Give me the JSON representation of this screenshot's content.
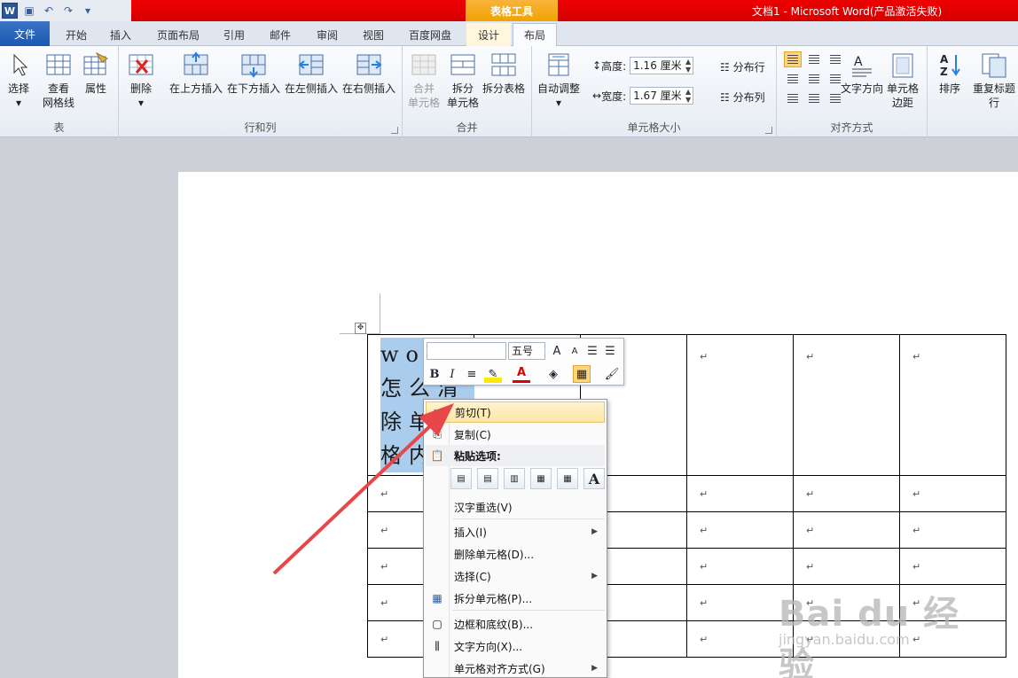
{
  "qat": {
    "logo": "W",
    "save": "▣",
    "undo": "↶",
    "redo": "↷"
  },
  "context_group": "表格工具",
  "window_title": "文档1 - Microsoft Word(产品激活失败)",
  "tabs": {
    "file": "文件",
    "home": "开始",
    "insert": "插入",
    "layout": "页面布局",
    "references": "引用",
    "mailings": "邮件",
    "review": "审阅",
    "view": "视图",
    "baidu": "百度网盘",
    "design": "设计",
    "table_layout": "布局"
  },
  "ribbon": {
    "table": {
      "label": "表",
      "select": "选择",
      "gridlines_1": "查看",
      "gridlines_2": "网格线",
      "properties": "属性"
    },
    "rows_cols": {
      "label": "行和列",
      "delete": "删除",
      "insert_above": "在上方插入",
      "insert_below": "在下方插入",
      "insert_left": "在左侧插入",
      "insert_right": "在右侧插入"
    },
    "merge": {
      "label": "合并",
      "merge_1": "合并",
      "merge_2": "单元格",
      "split_cells_1": "拆分",
      "split_cells_2": "单元格",
      "split_table": "拆分表格"
    },
    "cell_size": {
      "label": "单元格大小",
      "autofit": "自动调整",
      "height_label": "高度:",
      "height_value": "1.16 厘米",
      "width_label": "宽度:",
      "width_value": "1.67 厘米",
      "dist_rows": "分布行",
      "dist_cols": "分布列"
    },
    "alignment": {
      "label": "对齐方式",
      "text_direction": "文字方向",
      "cell_margins_1": "单元格",
      "cell_margins_2": "边距"
    },
    "data": {
      "sort": "排序",
      "repeat_header": "重复标题行"
    }
  },
  "document": {
    "cell_text": "word怎么清除单元格内容",
    "para_mark": "↵"
  },
  "mini_toolbar": {
    "font_size": "五号",
    "bold": "B",
    "italic": "I"
  },
  "context_menu": {
    "cut": "剪切(T)",
    "copy": "复制(C)",
    "paste_options": "粘贴选项:",
    "paste_letter": "A",
    "hanzi_reselect": "汉字重选(V)",
    "insert": "插入(I)",
    "delete_cells": "删除单元格(D)...",
    "select": "选择(C)",
    "split_cells": "拆分单元格(P)...",
    "borders_shading": "边框和底纹(B)...",
    "text_direction": "文字方向(X)...",
    "cell_alignment": "单元格对齐方式(G)"
  },
  "watermark": {
    "line1": "Bai du 经验",
    "line2": "jingyan.baidu.com"
  },
  "colors": {
    "title_red": "#e00000",
    "context_orange": "#f0a300",
    "selection_blue": "#aacdee",
    "arrow_red": "#e8474a"
  }
}
